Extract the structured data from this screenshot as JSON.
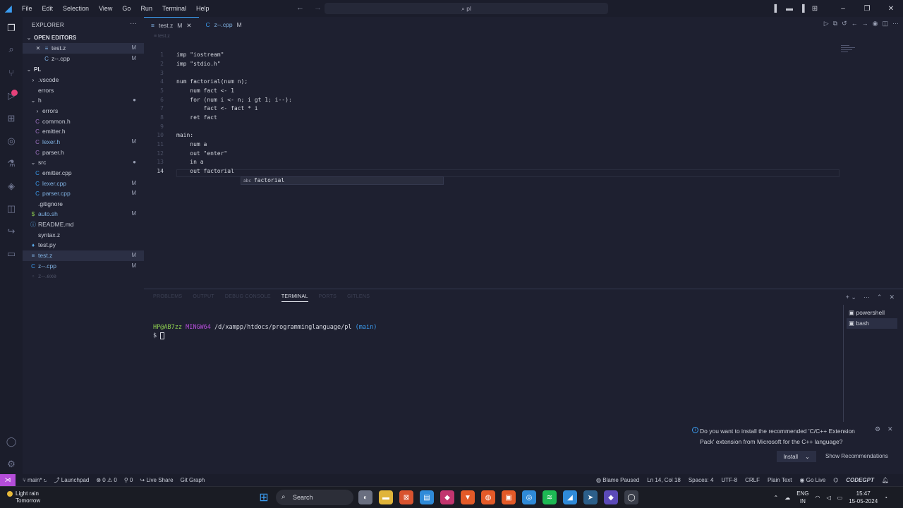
{
  "menu": [
    "File",
    "Edit",
    "Selection",
    "View",
    "Go",
    "Run",
    "Terminal",
    "Help"
  ],
  "search": {
    "text": "pl"
  },
  "explorer": {
    "title": "EXPLORER",
    "open_editors_title": "OPEN EDITORS",
    "open_editors": [
      {
        "name": "test.z",
        "badge": "M"
      },
      {
        "name": "z--.cpp",
        "badge": "M"
      }
    ],
    "folder_title": "PL",
    "tree": [
      {
        "name": ".vscode",
        "badge": ""
      },
      {
        "name": "errors",
        "badge": ""
      },
      {
        "name": "h",
        "badge": ""
      },
      {
        "name": "errors",
        "badge": ""
      },
      {
        "name": "common.h",
        "badge": ""
      },
      {
        "name": "emitter.h",
        "badge": ""
      },
      {
        "name": "lexer.h",
        "badge": "M"
      },
      {
        "name": "parser.h",
        "badge": ""
      },
      {
        "name": "src",
        "badge": ""
      },
      {
        "name": "emitter.cpp",
        "badge": ""
      },
      {
        "name": "lexer.cpp",
        "badge": "M"
      },
      {
        "name": "parser.cpp",
        "badge": "M"
      },
      {
        "name": ".gitignore",
        "badge": ""
      },
      {
        "name": "auto.sh",
        "badge": "M"
      },
      {
        "name": "README.md",
        "badge": ""
      },
      {
        "name": "syntax.z",
        "badge": ""
      },
      {
        "name": "test.py",
        "badge": ""
      },
      {
        "name": "test.z",
        "badge": "M"
      },
      {
        "name": "z--.cpp",
        "badge": "M"
      },
      {
        "name": "z--.exe",
        "badge": ""
      }
    ]
  },
  "tabs": [
    {
      "label": "test.z",
      "badge": "M"
    },
    {
      "label": "z--.cpp",
      "badge": "M"
    }
  ],
  "code": {
    "line_numbers": [
      "1",
      "2",
      "3",
      "4",
      "5",
      "6",
      "7",
      "8",
      "9",
      "10",
      "11",
      "12",
      "13",
      "14"
    ],
    "lines": [
      "imp \"iostream\"",
      "imp \"stdio.h\"",
      "",
      "num factorial(num n);",
      "    num fact <- 1",
      "    for (num i <- n; i gt 1; i--):",
      "        fact <- fact * i",
      "    ret fact",
      "",
      "main:",
      "    num a",
      "    out \"enter\"",
      "    in a",
      "    out factorial"
    ],
    "suggestion_kind": "abc",
    "suggestion": "factorial"
  },
  "panel": {
    "tabs": [
      "PROBLEMS",
      "OUTPUT",
      "DEBUG CONSOLE",
      "TERMINAL",
      "PORTS",
      "GITLENS"
    ],
    "terminal_user": "HP@AB7zz",
    "terminal_env": "MINGW64",
    "terminal_path": "/d/xampp/htdocs/programminglanguage/pl",
    "terminal_branch": "(main)",
    "terminal_prompt": "$",
    "terminals": [
      "powershell",
      "bash"
    ]
  },
  "notification": {
    "message": "Do you want to install the recommended 'C/C++ Extension Pack' extension from Microsoft for the C++ language?",
    "install": "Install",
    "show": "Show Recommendations"
  },
  "statusbar": {
    "branch": "main*",
    "launchpad": "Launchpad",
    "problems": "0",
    "warnings": "0",
    "ports": "0",
    "liveshare": "Live Share",
    "gitgraph": "Git Graph",
    "blame": "Blame Paused",
    "position": "Ln 14, Col 18",
    "spaces": "Spaces: 4",
    "encoding": "UTF-8",
    "eol": "CRLF",
    "language": "Plain Text",
    "golive": "Go Live",
    "brand": "CODEGPT"
  },
  "taskbar": {
    "weather_title": "Light rain",
    "weather_sub": "Tomorrow",
    "search": "Search",
    "lang1": "ENG",
    "lang2": "IN",
    "time": "15:47",
    "date": "15-05-2024"
  },
  "colors": {
    "accent": "#3b9cf0",
    "remote": "#b44dd8",
    "badge": "#e6417a",
    "user": "#8fd14f",
    "env": "#b44dd8",
    "branch": "#3b9cf0"
  }
}
